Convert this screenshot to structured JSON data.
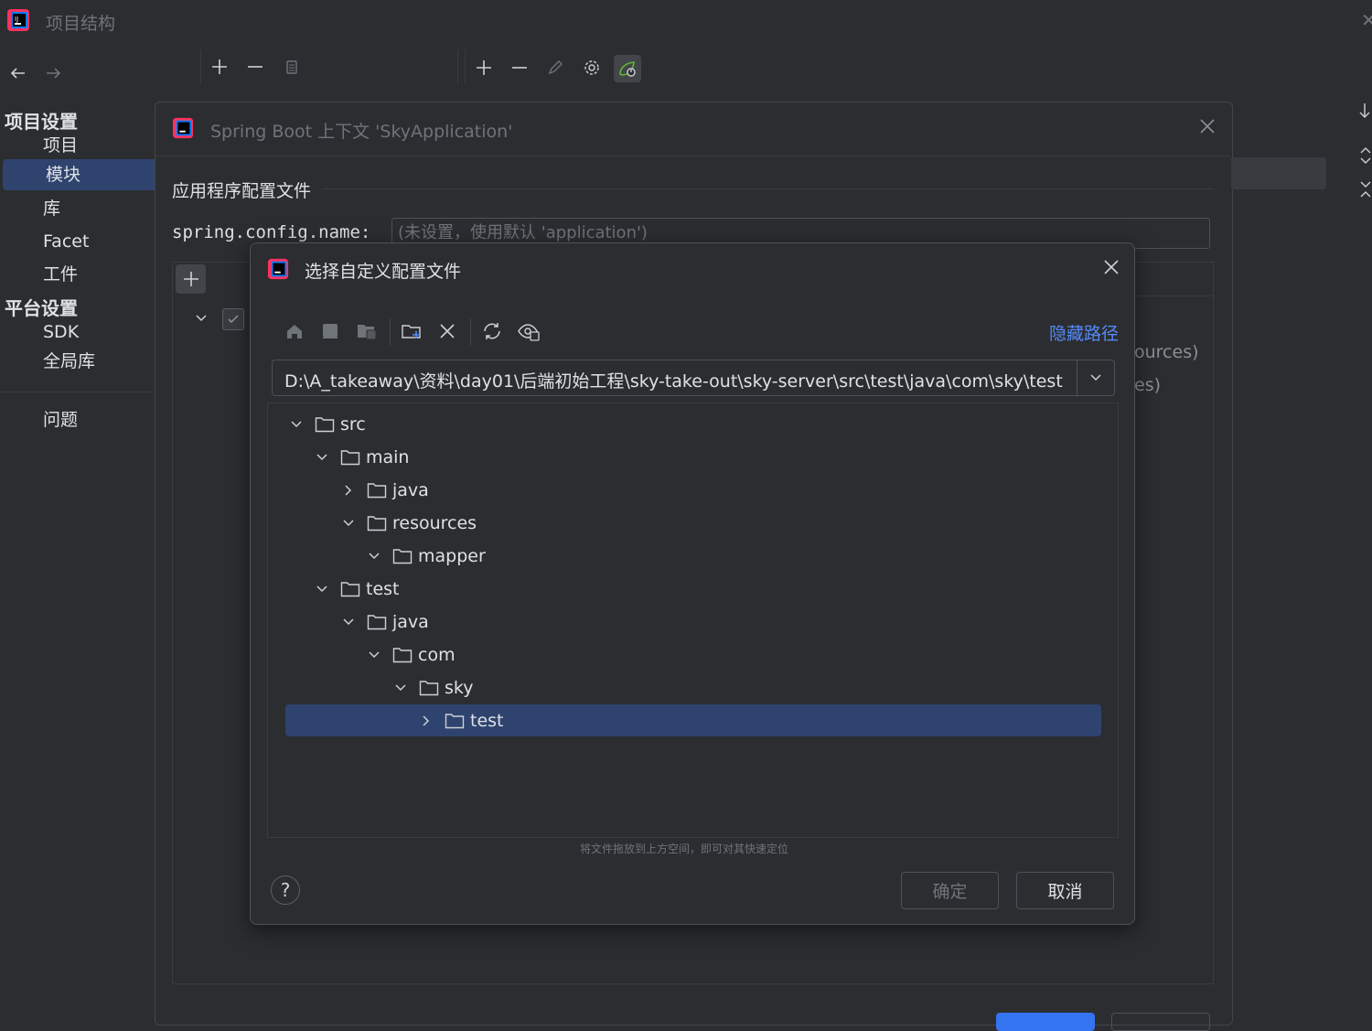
{
  "window": {
    "title": "项目结构"
  },
  "sidebar": {
    "project_settings_header": "项目设置",
    "platform_settings_header": "平台设置",
    "items": [
      {
        "label": "项目"
      },
      {
        "label": "模块"
      },
      {
        "label": "库"
      },
      {
        "label": "Facet"
      },
      {
        "label": "工件"
      },
      {
        "label": "SDK"
      },
      {
        "label": "全局库"
      },
      {
        "label": "问题"
      }
    ],
    "selected": "模块"
  },
  "spring_dialog": {
    "title": "Spring Boot 上下文 'SkyApplication'",
    "section_title": "应用程序配置文件",
    "config_label": "spring.config.name:",
    "config_placeholder": "(未设置，使用默认 'application')",
    "bg_fragment_1": "ources)",
    "bg_fragment_2": "es)"
  },
  "file_chooser": {
    "title": "选择自定义配置文件",
    "hide_path_link": "隐藏路径",
    "path": "D:\\A_takeaway\\资料\\day01\\后端初始工程\\sky-take-out\\sky-server\\src\\test\\java\\com\\sky\\test",
    "toolbar_icons": [
      "home-icon",
      "desktop-icon",
      "project-folder-icon",
      "new-folder-icon",
      "delete-icon",
      "refresh-icon",
      "show-hidden-icon"
    ],
    "tree": [
      {
        "label": "src",
        "expanded": true,
        "level": 0
      },
      {
        "label": "main",
        "expanded": true,
        "level": 1
      },
      {
        "label": "java",
        "expanded": false,
        "level": 2
      },
      {
        "label": "resources",
        "expanded": true,
        "level": 2
      },
      {
        "label": "mapper",
        "expanded": true,
        "level": 3
      },
      {
        "label": "test",
        "expanded": true,
        "level": 1
      },
      {
        "label": "java",
        "expanded": true,
        "level": 2
      },
      {
        "label": "com",
        "expanded": true,
        "level": 3
      },
      {
        "label": "sky",
        "expanded": true,
        "level": 4
      },
      {
        "label": "test",
        "expanded": false,
        "level": 5,
        "selected": true
      }
    ],
    "drop_hint": "将文件拖放到上方空间，即可对其快速定位",
    "ok_label": "确定",
    "cancel_label": "取消",
    "help_label": "?"
  },
  "colors": {
    "background": "#2b2d30",
    "selection": "#2e436e",
    "link": "#548af7",
    "primary_button": "#3574f0"
  }
}
